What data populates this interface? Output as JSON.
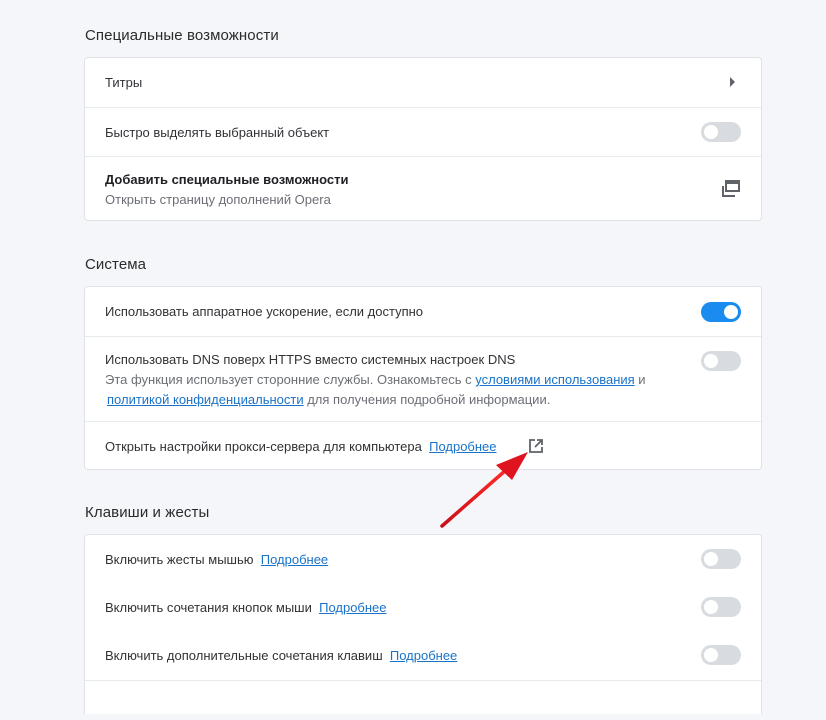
{
  "accessibility": {
    "title": "Специальные возможности",
    "captions_label": "Титры",
    "quick_select_label": "Быстро выделять выбранный объект",
    "quick_select_on": false,
    "add_accessibility_label": "Добавить специальные возможности",
    "add_accessibility_sub": "Открыть страницу дополнений Opera"
  },
  "system": {
    "title": "Система",
    "hw_accel_label": "Использовать аппаратное ускорение, если доступно",
    "hw_accel_on": true,
    "dns_label": "Использовать DNS поверх HTTPS вместо системных настроек DNS",
    "dns_desc_part1": "Эта функция использует сторонние службы. Ознакомьтесь с ",
    "dns_terms_link": "условиями использования",
    "dns_desc_part2": " и",
    "dns_privacy_link": "политикой конфиденциальности",
    "dns_desc_part3": " для получения подробной информации.",
    "dns_on": false,
    "proxy_label": "Открыть настройки прокси-сервера для компьютера",
    "proxy_link": "Подробнее"
  },
  "shortcuts": {
    "title": "Клавиши и жесты",
    "mouse_gestures_label": "Включить жесты мышью",
    "mouse_gestures_link": "Подробнее",
    "mouse_gestures_on": false,
    "rocker_label": "Включить сочетания кнопок мыши",
    "rocker_link": "Подробнее",
    "rocker_on": false,
    "extra_keys_label": "Включить дополнительные сочетания клавиш",
    "extra_keys_link": "Подробнее",
    "extra_keys_on": false
  },
  "colors": {
    "toggle_on": "#1a8cf0",
    "toggle_off": "#d8dbdf",
    "link": "#1a73c8",
    "annotation_arrow": "#e0141e"
  },
  "icons": {
    "captions": "chevron-right-icon",
    "add_accessibility": "open-in-new-window-icon",
    "proxy": "external-link-icon",
    "annotation": "red-arrow-annotation"
  }
}
